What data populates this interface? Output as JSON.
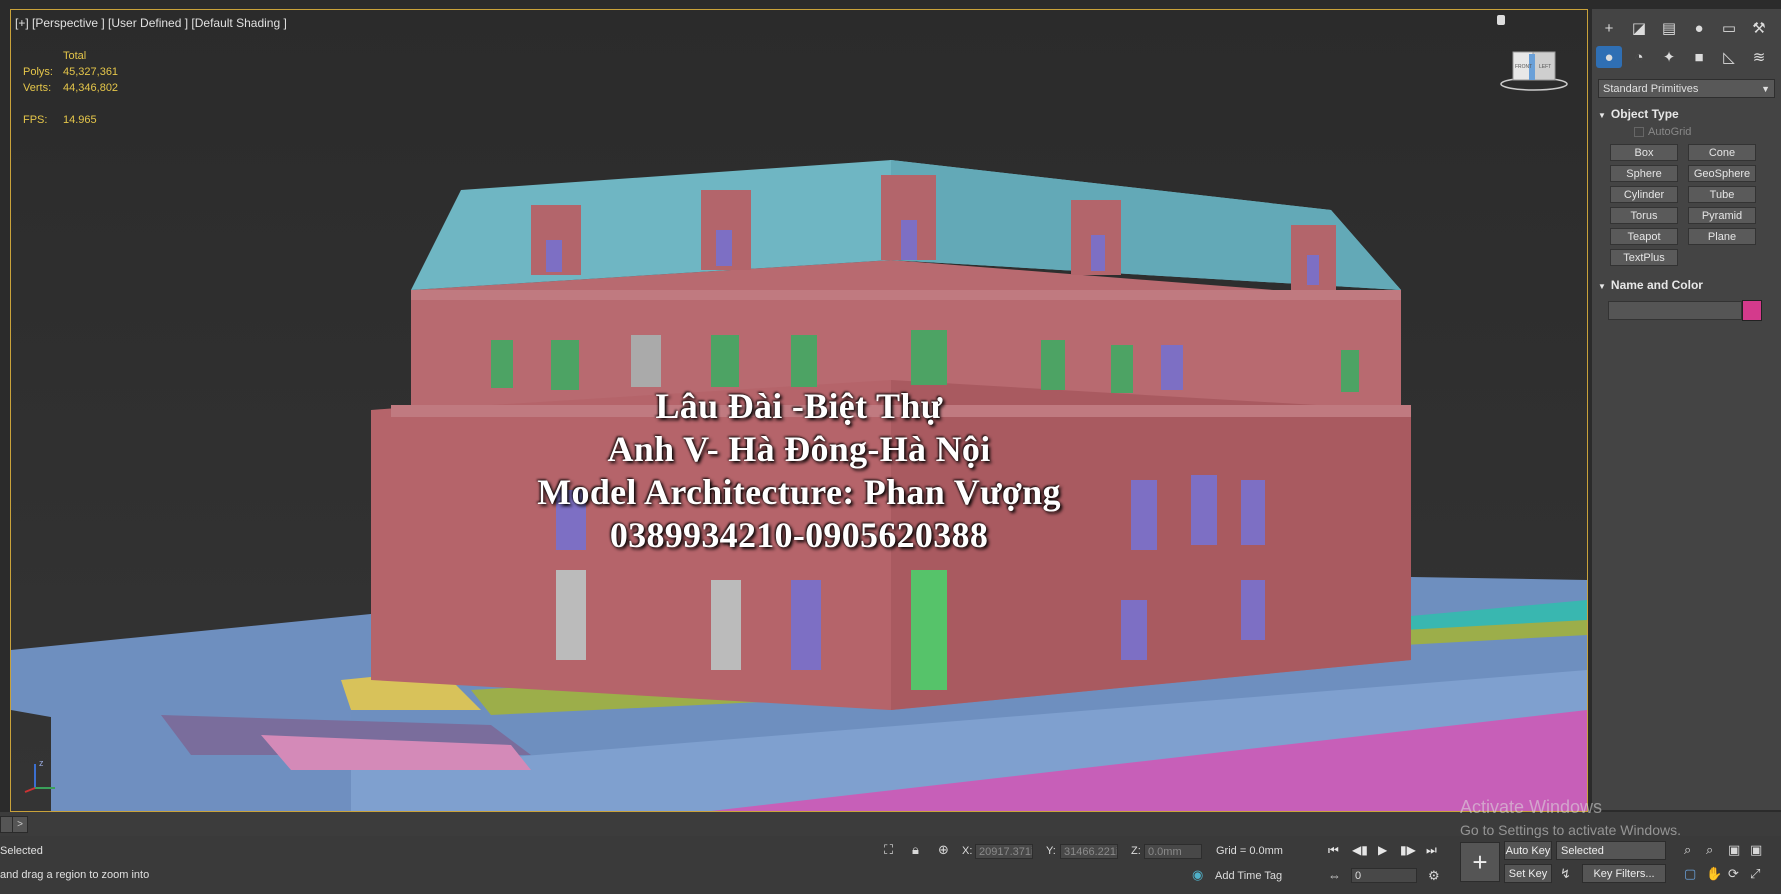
{
  "viewport": {
    "label": "[+] [Perspective ] [User Defined ] [Default Shading ]",
    "stats": {
      "total_label": "Total",
      "polys_label": "Polys:",
      "polys_value": "45,327,361",
      "verts_label": "Verts:",
      "verts_value": "44,346,802",
      "fps_label": "FPS:",
      "fps_value": "14.965"
    },
    "overlay_lines": [
      "Lâu Đài -Biệt Thự",
      "Anh V- Hà Đông-Hà Nội",
      "Model Architecture: Phan Vượng",
      "0389934210-0905620388"
    ],
    "axis_label": "z",
    "nav_cube_labels": [
      "FRONT",
      "LEFT"
    ]
  },
  "command_panel": {
    "tabs": [
      "create-icon",
      "modify-icon",
      "hierarchy-icon",
      "motion-icon",
      "display-icon",
      "utilities-icon"
    ],
    "subtabs": [
      "geometry-icon",
      "shapes-icon",
      "lights-icon",
      "cameras-icon",
      "helpers-icon",
      "spacewarps-icon",
      "systems-icon"
    ],
    "dropdown": "Standard Primitives",
    "object_type_title": "Object Type",
    "autogrid_label": "AutoGrid",
    "buttons": [
      "Box",
      "Cone",
      "Sphere",
      "GeoSphere",
      "Cylinder",
      "Tube",
      "Torus",
      "Pyramid",
      "Teapot",
      "Plane",
      "TextPlus"
    ],
    "name_color_title": "Name and Color",
    "object_color": "#d43a8c"
  },
  "status_bar": {
    "selected_text": "Selected",
    "prompt_text": "and drag a region to zoom into",
    "x_label": "X:",
    "x_value": "20917.371i",
    "y_label": "Y:",
    "y_value": "31466.221i",
    "z_label": "Z:",
    "z_value": "0.0mm",
    "grid_text": "Grid = 0.0mm",
    "add_time_tag": "Add Time Tag",
    "frame_value": "0",
    "auto_key": "Auto Key",
    "selected_dropdown": "Selected",
    "set_key": "Set Key",
    "key_filters": "Key Filters...",
    "timeline_arrow": ">"
  },
  "watermark": {
    "line1": "Activate Windows",
    "line2": "Go to Settings to activate Windows."
  }
}
